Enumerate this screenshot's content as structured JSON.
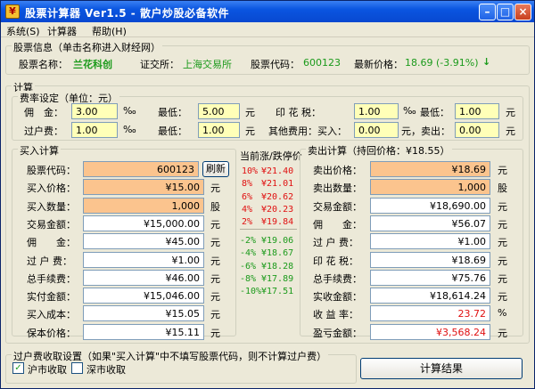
{
  "window": {
    "title": "股票计算器 Ver1.5 - 散户炒股必备软件",
    "icon": "app-icon"
  },
  "menu": [
    "系统(S)",
    "计算器",
    "帮助(H)"
  ],
  "info": {
    "group_label": "股票信息（单击名称进入财经网）",
    "name_label": "股票名称：",
    "name": "兰花科创",
    "exchange_label": "证交所：",
    "exchange": "上海交易所",
    "code_label": "股票代码：",
    "code": "600123",
    "price_label": "最新价格：",
    "price": "18.69 (-3.91%)",
    "trend_icon": "down-arrow-icon"
  },
  "calc": {
    "group_label": "计算"
  },
  "fees": {
    "group_label": "费率设定（单位：元）",
    "commission_label": "佣　金：",
    "commission": "3.00",
    "commission_unit": "‰",
    "commission_min_label": "最低：",
    "commission_min": "5.00",
    "commission_min_unit": "元",
    "stamp_label": "印 花 税：",
    "stamp": "1.00",
    "stamp_unit": "‰",
    "stamp_min_label": "最低：",
    "stamp_min": "1.00",
    "stamp_min_unit": "元",
    "transfer_label": "过户费：",
    "transfer": "1.00",
    "transfer_unit": "‰",
    "transfer_min_label": "最低：",
    "transfer_min": "1.00",
    "transfer_min_unit": "元",
    "other_label": "其他费用：买入：",
    "other_buy": "0.00",
    "other_sell_label": "元，卖出：",
    "other_sell": "0.00",
    "other_sell_unit": "元"
  },
  "buy": {
    "group_label": "买入计算",
    "refresh_button": "刷新",
    "rows": [
      {
        "label": "股票代码：",
        "value": "600123",
        "unit": "",
        "style": "org"
      },
      {
        "label": "买入价格：",
        "value": "¥15.00",
        "unit": "元",
        "style": "org"
      },
      {
        "label": "买入数量：",
        "value": "1,000",
        "unit": "股",
        "style": "org"
      },
      {
        "label": "交易金额：",
        "value": "¥15,000.00",
        "unit": "元",
        "style": "wht"
      },
      {
        "label": "佣　　金：",
        "value": "¥45.00",
        "unit": "元",
        "style": "wht"
      },
      {
        "label": "过 户 费：",
        "value": "¥1.00",
        "unit": "元",
        "style": "wht"
      },
      {
        "label": "总手续费：",
        "value": "¥46.00",
        "unit": "元",
        "style": "wht"
      },
      {
        "label": "实付金额：",
        "value": "¥15,046.00",
        "unit": "元",
        "style": "wht"
      },
      {
        "label": "买入成本：",
        "value": "¥15.05",
        "unit": "元",
        "style": "wht"
      },
      {
        "label": "保本价格：",
        "value": "¥15.11",
        "unit": "元",
        "style": "wht"
      }
    ]
  },
  "limits": {
    "title": "当前涨/跌停价",
    "up": [
      {
        "pct": "10%",
        "price": "¥21.40"
      },
      {
        "pct": "8%",
        "price": "¥21.01"
      },
      {
        "pct": "6%",
        "price": "¥20.62"
      },
      {
        "pct": "4%",
        "price": "¥20.23"
      },
      {
        "pct": "2%",
        "price": "¥19.84"
      }
    ],
    "down": [
      {
        "pct": "-2%",
        "price": "¥19.06"
      },
      {
        "pct": "-4%",
        "price": "¥18.67"
      },
      {
        "pct": "-6%",
        "price": "¥18.28"
      },
      {
        "pct": "-8%",
        "price": "¥17.89"
      },
      {
        "pct": "-10%",
        "price": "¥17.51"
      }
    ]
  },
  "sell": {
    "group_label": "卖出计算（持回价格：¥18.55）",
    "rows": [
      {
        "label": "卖出价格：",
        "value": "¥18.69",
        "unit": "元",
        "style": "org",
        "color": ""
      },
      {
        "label": "卖出数量：",
        "value": "1,000",
        "unit": "股",
        "style": "org",
        "color": ""
      },
      {
        "label": "交易金额：",
        "value": "¥18,690.00",
        "unit": "元",
        "style": "wht",
        "color": ""
      },
      {
        "label": "佣　　金：",
        "value": "¥56.07",
        "unit": "元",
        "style": "wht",
        "color": ""
      },
      {
        "label": "过 户 费：",
        "value": "¥1.00",
        "unit": "元",
        "style": "wht",
        "color": ""
      },
      {
        "label": "印 花 税：",
        "value": "¥18.69",
        "unit": "元",
        "style": "wht",
        "color": ""
      },
      {
        "label": "总手续费：",
        "value": "¥75.76",
        "unit": "元",
        "style": "wht",
        "color": ""
      },
      {
        "label": "实收金额：",
        "value": "¥18,614.24",
        "unit": "元",
        "style": "wht",
        "color": ""
      },
      {
        "label": "收 益 率：",
        "value": "23.72",
        "unit": "%",
        "style": "wht",
        "color": "#e01010"
      },
      {
        "label": "盈亏金额：",
        "value": "¥3,568.24",
        "unit": "元",
        "style": "wht",
        "color": "#e01010"
      }
    ]
  },
  "transfer_setting": {
    "group_label": "过户费收取设置（如果\"买入计算\"中不填写股票代码，则不计算过户费）",
    "sh_label": "沪市收取",
    "sh_checked": "✓",
    "sz_label": "深市收取",
    "sz_checked": ""
  },
  "calc_button": "计算结果"
}
